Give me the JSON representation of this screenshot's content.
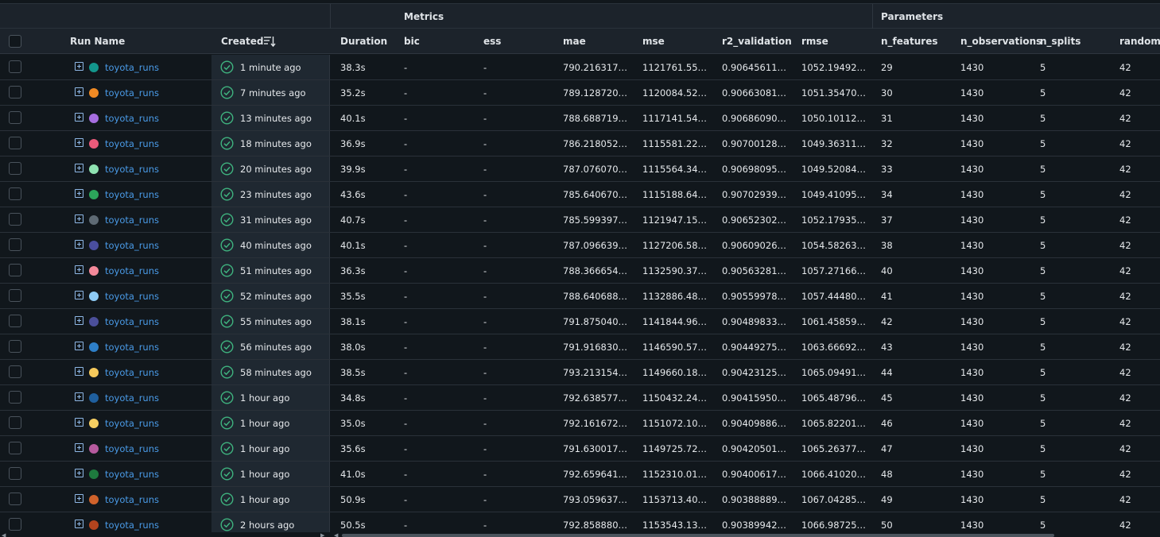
{
  "groups": {
    "metrics": "Metrics",
    "parameters": "Parameters"
  },
  "columns": {
    "run_name": "Run Name",
    "created": "Created",
    "duration": "Duration",
    "bic": "bic",
    "ess": "ess",
    "mae": "mae",
    "mse": "mse",
    "r2_validation": "r2_validation",
    "rmse": "rmse",
    "n_features": "n_features",
    "n_observations": "n_observations",
    "n_splits": "n_splits",
    "random_state": "random_s"
  },
  "colors": {
    "accent": "#4a9be8",
    "success": "#3fb37f"
  },
  "rows": [
    {
      "color": "#13968c",
      "name": "toyota_runs",
      "created": "1 minute ago",
      "duration": "38.3s",
      "bic": "-",
      "ess": "-",
      "mae": "790.216317…",
      "mse": "1121761.55…",
      "r2": "0.90645611…",
      "rmse": "1052.19492…",
      "n_features": "29",
      "n_obs": "1430",
      "n_splits": "5",
      "random_state": "42"
    },
    {
      "color": "#f08a24",
      "name": "toyota_runs",
      "created": "7 minutes ago",
      "duration": "35.2s",
      "bic": "-",
      "ess": "-",
      "mae": "789.128720…",
      "mse": "1120084.52…",
      "r2": "0.90663081…",
      "rmse": "1051.35470…",
      "n_features": "30",
      "n_obs": "1430",
      "n_splits": "5",
      "random_state": "42"
    },
    {
      "color": "#a66ee0",
      "name": "toyota_runs",
      "created": "13 minutes ago",
      "duration": "40.1s",
      "bic": "-",
      "ess": "-",
      "mae": "788.688719…",
      "mse": "1117141.54…",
      "r2": "0.90686090…",
      "rmse": "1050.10112…",
      "n_features": "31",
      "n_obs": "1430",
      "n_splits": "5",
      "random_state": "42"
    },
    {
      "color": "#ea5a7a",
      "name": "toyota_runs",
      "created": "18 minutes ago",
      "duration": "36.9s",
      "bic": "-",
      "ess": "-",
      "mae": "786.218052…",
      "mse": "1115581.22…",
      "r2": "0.90700128…",
      "rmse": "1049.36311…",
      "n_features": "32",
      "n_obs": "1430",
      "n_splits": "5",
      "random_state": "42"
    },
    {
      "color": "#8fe3b2",
      "name": "toyota_runs",
      "created": "20 minutes ago",
      "duration": "39.9s",
      "bic": "-",
      "ess": "-",
      "mae": "787.076070…",
      "mse": "1115564.34…",
      "r2": "0.90698095…",
      "rmse": "1049.52084…",
      "n_features": "33",
      "n_obs": "1430",
      "n_splits": "5",
      "random_state": "42"
    },
    {
      "color": "#2ca55b",
      "name": "toyota_runs",
      "created": "23 minutes ago",
      "duration": "43.6s",
      "bic": "-",
      "ess": "-",
      "mae": "785.640670…",
      "mse": "1115188.64…",
      "r2": "0.90702939…",
      "rmse": "1049.41095…",
      "n_features": "34",
      "n_obs": "1430",
      "n_splits": "5",
      "random_state": "42"
    },
    {
      "color": "#5e6a74",
      "name": "toyota_runs",
      "created": "31 minutes ago",
      "duration": "40.7s",
      "bic": "-",
      "ess": "-",
      "mae": "785.599397…",
      "mse": "1121947.15…",
      "r2": "0.90652302…",
      "rmse": "1052.17935…",
      "n_features": "37",
      "n_obs": "1430",
      "n_splits": "5",
      "random_state": "42"
    },
    {
      "color": "#4a4e9e",
      "name": "toyota_runs",
      "created": "40 minutes ago",
      "duration": "40.1s",
      "bic": "-",
      "ess": "-",
      "mae": "787.096639…",
      "mse": "1127206.58…",
      "r2": "0.90609026…",
      "rmse": "1054.58263…",
      "n_features": "38",
      "n_obs": "1430",
      "n_splits": "5",
      "random_state": "42"
    },
    {
      "color": "#f4899a",
      "name": "toyota_runs",
      "created": "51 minutes ago",
      "duration": "36.3s",
      "bic": "-",
      "ess": "-",
      "mae": "788.366654…",
      "mse": "1132590.37…",
      "r2": "0.90563281…",
      "rmse": "1057.27166…",
      "n_features": "40",
      "n_obs": "1430",
      "n_splits": "5",
      "random_state": "42"
    },
    {
      "color": "#8ecbf5",
      "name": "toyota_runs",
      "created": "52 minutes ago",
      "duration": "35.5s",
      "bic": "-",
      "ess": "-",
      "mae": "788.640688…",
      "mse": "1132886.48…",
      "r2": "0.90559978…",
      "rmse": "1057.44480…",
      "n_features": "41",
      "n_obs": "1430",
      "n_splits": "5",
      "random_state": "42"
    },
    {
      "color": "#4b4f9a",
      "name": "toyota_runs",
      "created": "55 minutes ago",
      "duration": "38.1s",
      "bic": "-",
      "ess": "-",
      "mae": "791.875040…",
      "mse": "1141844.96…",
      "r2": "0.90489833…",
      "rmse": "1061.45859…",
      "n_features": "42",
      "n_obs": "1430",
      "n_splits": "5",
      "random_state": "42"
    },
    {
      "color": "#2e7fc8",
      "name": "toyota_runs",
      "created": "56 minutes ago",
      "duration": "38.0s",
      "bic": "-",
      "ess": "-",
      "mae": "791.916830…",
      "mse": "1146590.57…",
      "r2": "0.90449275…",
      "rmse": "1063.66692…",
      "n_features": "43",
      "n_obs": "1430",
      "n_splits": "5",
      "random_state": "42"
    },
    {
      "color": "#f5c95c",
      "name": "toyota_runs",
      "created": "58 minutes ago",
      "duration": "38.5s",
      "bic": "-",
      "ess": "-",
      "mae": "793.213154…",
      "mse": "1149660.18…",
      "r2": "0.90423125…",
      "rmse": "1065.09491…",
      "n_features": "44",
      "n_obs": "1430",
      "n_splits": "5",
      "random_state": "42"
    },
    {
      "color": "#1f5f9e",
      "name": "toyota_runs",
      "created": "1 hour ago",
      "duration": "34.8s",
      "bic": "-",
      "ess": "-",
      "mae": "792.638577…",
      "mse": "1150432.24…",
      "r2": "0.90415950…",
      "rmse": "1065.48796…",
      "n_features": "45",
      "n_obs": "1430",
      "n_splits": "5",
      "random_state": "42"
    },
    {
      "color": "#f6cf62",
      "name": "toyota_runs",
      "created": "1 hour ago",
      "duration": "35.0s",
      "bic": "-",
      "ess": "-",
      "mae": "792.161672…",
      "mse": "1151072.10…",
      "r2": "0.90409886…",
      "rmse": "1065.82201…",
      "n_features": "46",
      "n_obs": "1430",
      "n_splits": "5",
      "random_state": "42"
    },
    {
      "color": "#b65a9e",
      "name": "toyota_runs",
      "created": "1 hour ago",
      "duration": "35.6s",
      "bic": "-",
      "ess": "-",
      "mae": "791.630017…",
      "mse": "1149725.72…",
      "r2": "0.90420501…",
      "rmse": "1065.26377…",
      "n_features": "47",
      "n_obs": "1430",
      "n_splits": "5",
      "random_state": "42"
    },
    {
      "color": "#1e7a3e",
      "name": "toyota_runs",
      "created": "1 hour ago",
      "duration": "41.0s",
      "bic": "-",
      "ess": "-",
      "mae": "792.659641…",
      "mse": "1152310.01…",
      "r2": "0.90400617…",
      "rmse": "1066.41020…",
      "n_features": "48",
      "n_obs": "1430",
      "n_splits": "5",
      "random_state": "42"
    },
    {
      "color": "#d0622b",
      "name": "toyota_runs",
      "created": "1 hour ago",
      "duration": "50.9s",
      "bic": "-",
      "ess": "-",
      "mae": "793.059637…",
      "mse": "1153713.40…",
      "r2": "0.90388889…",
      "rmse": "1067.04285…",
      "n_features": "49",
      "n_obs": "1430",
      "n_splits": "5",
      "random_state": "42"
    },
    {
      "color": "#b3441e",
      "name": "toyota_runs",
      "created": "2 hours ago",
      "duration": "50.5s",
      "bic": "-",
      "ess": "-",
      "mae": "792.858880…",
      "mse": "1153543.13…",
      "r2": "0.90389942…",
      "rmse": "1066.98725…",
      "n_features": "50",
      "n_obs": "1430",
      "n_splits": "5",
      "random_state": "42"
    }
  ]
}
